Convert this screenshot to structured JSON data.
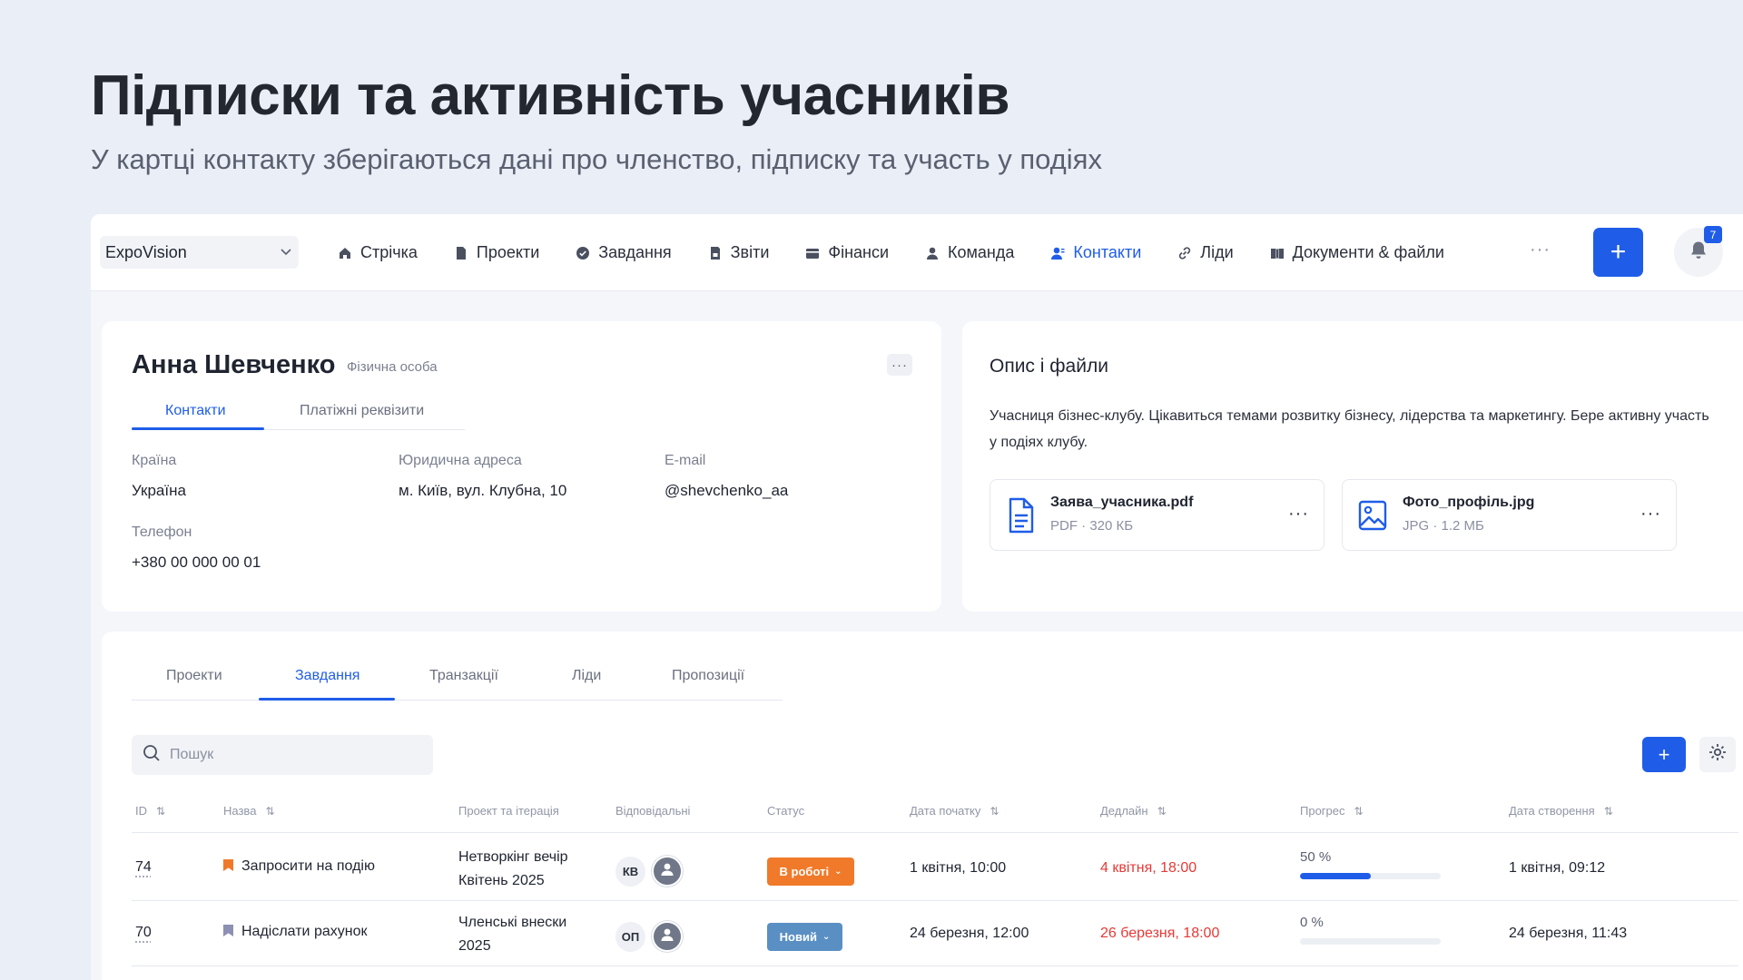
{
  "hero": {
    "title": "Підписки та активність учасників",
    "subtitle": "У картці контакту зберігаються дані про членство, підписку та участь у подіях"
  },
  "topbar": {
    "workspace": "ExpoVision",
    "nav": [
      {
        "label": "Стрічка",
        "icon": "home-icon",
        "active": false
      },
      {
        "label": "Проекти",
        "icon": "document-icon",
        "active": false
      },
      {
        "label": "Завдання",
        "icon": "check-circle-icon",
        "active": false
      },
      {
        "label": "Звіти",
        "icon": "report-icon",
        "active": false
      },
      {
        "label": "Фінанси",
        "icon": "wallet-icon",
        "active": false
      },
      {
        "label": "Команда",
        "icon": "user-icon",
        "active": false
      },
      {
        "label": "Контакти",
        "icon": "contacts-icon",
        "active": true
      },
      {
        "label": "Ліди",
        "icon": "link-icon",
        "active": false
      },
      {
        "label": "Документи & файли",
        "icon": "book-icon",
        "active": false
      }
    ],
    "more": "···",
    "plus": "+",
    "notifications_count": "7"
  },
  "contact": {
    "name": "Анна Шевченко",
    "type": "Фізична особа",
    "menu": "···",
    "tabs": [
      "Контакти",
      "Платіжні реквізити"
    ],
    "fields": {
      "country_label": "Країна",
      "country_value": "Україна",
      "address_label": "Юридична адреса",
      "address_value": "м. Київ, вул. Клубна, 10",
      "email_label": "E-mail",
      "email_value": "@shevchenko_aa",
      "phone_label": "Телефон",
      "phone_value": "+380 00 000 00 01"
    }
  },
  "files_card": {
    "title": "Опис і файли",
    "description": "Учасниця бізнес-клубу. Цікавиться темами розвитку бізнесу, лідерства та маркетингу. Бере активну участь у подіях клубу.",
    "files": [
      {
        "name": "Заява_учасника.pdf",
        "meta": "PDF · 320 КБ",
        "icon": "file-document-icon"
      },
      {
        "name": "Фото_профіль.jpg",
        "meta": "JPG · 1.2 МБ",
        "icon": "image-icon"
      }
    ],
    "file_menu": "···"
  },
  "tasks": {
    "tabs": [
      "Проекти",
      "Завдання",
      "Транзакції",
      "Ліди",
      "Пропозиції"
    ],
    "search_placeholder": "Пошук",
    "add": "+",
    "columns": {
      "id": "ID",
      "name": "Назва",
      "project": "Проект та ітерація",
      "assignees": "Відповідальні",
      "status": "Статус",
      "start": "Дата початку",
      "deadline": "Дедлайн",
      "progress": "Прогрес",
      "created": "Дата створення"
    },
    "rows": [
      {
        "id": "74",
        "name": "Запросити на подію",
        "flag_color": "#f07a2a",
        "project_line1": "Нетворкінг вечір",
        "project_line2": "Квітень 2025",
        "initials": "КВ",
        "status": "В роботі",
        "status_color": "#f07a2a",
        "start": "1 квітня, 10:00",
        "deadline": "4 квітня, 18:00",
        "progress_label": "50 %",
        "progress": 0.5,
        "created": "1 квітня, 09:12"
      },
      {
        "id": "70",
        "name": "Надіслати рахунок",
        "flag_color": "#8d8fb3",
        "project_line1": "Членські внески",
        "project_line2": "2025",
        "initials": "ОП",
        "status": "Новий",
        "status_color": "#5a8fc4",
        "start": "24 березня, 12:00",
        "deadline": "26 березня, 18:00",
        "progress_label": "0 %",
        "progress": 0,
        "created": "24 березня, 11:43"
      }
    ]
  }
}
